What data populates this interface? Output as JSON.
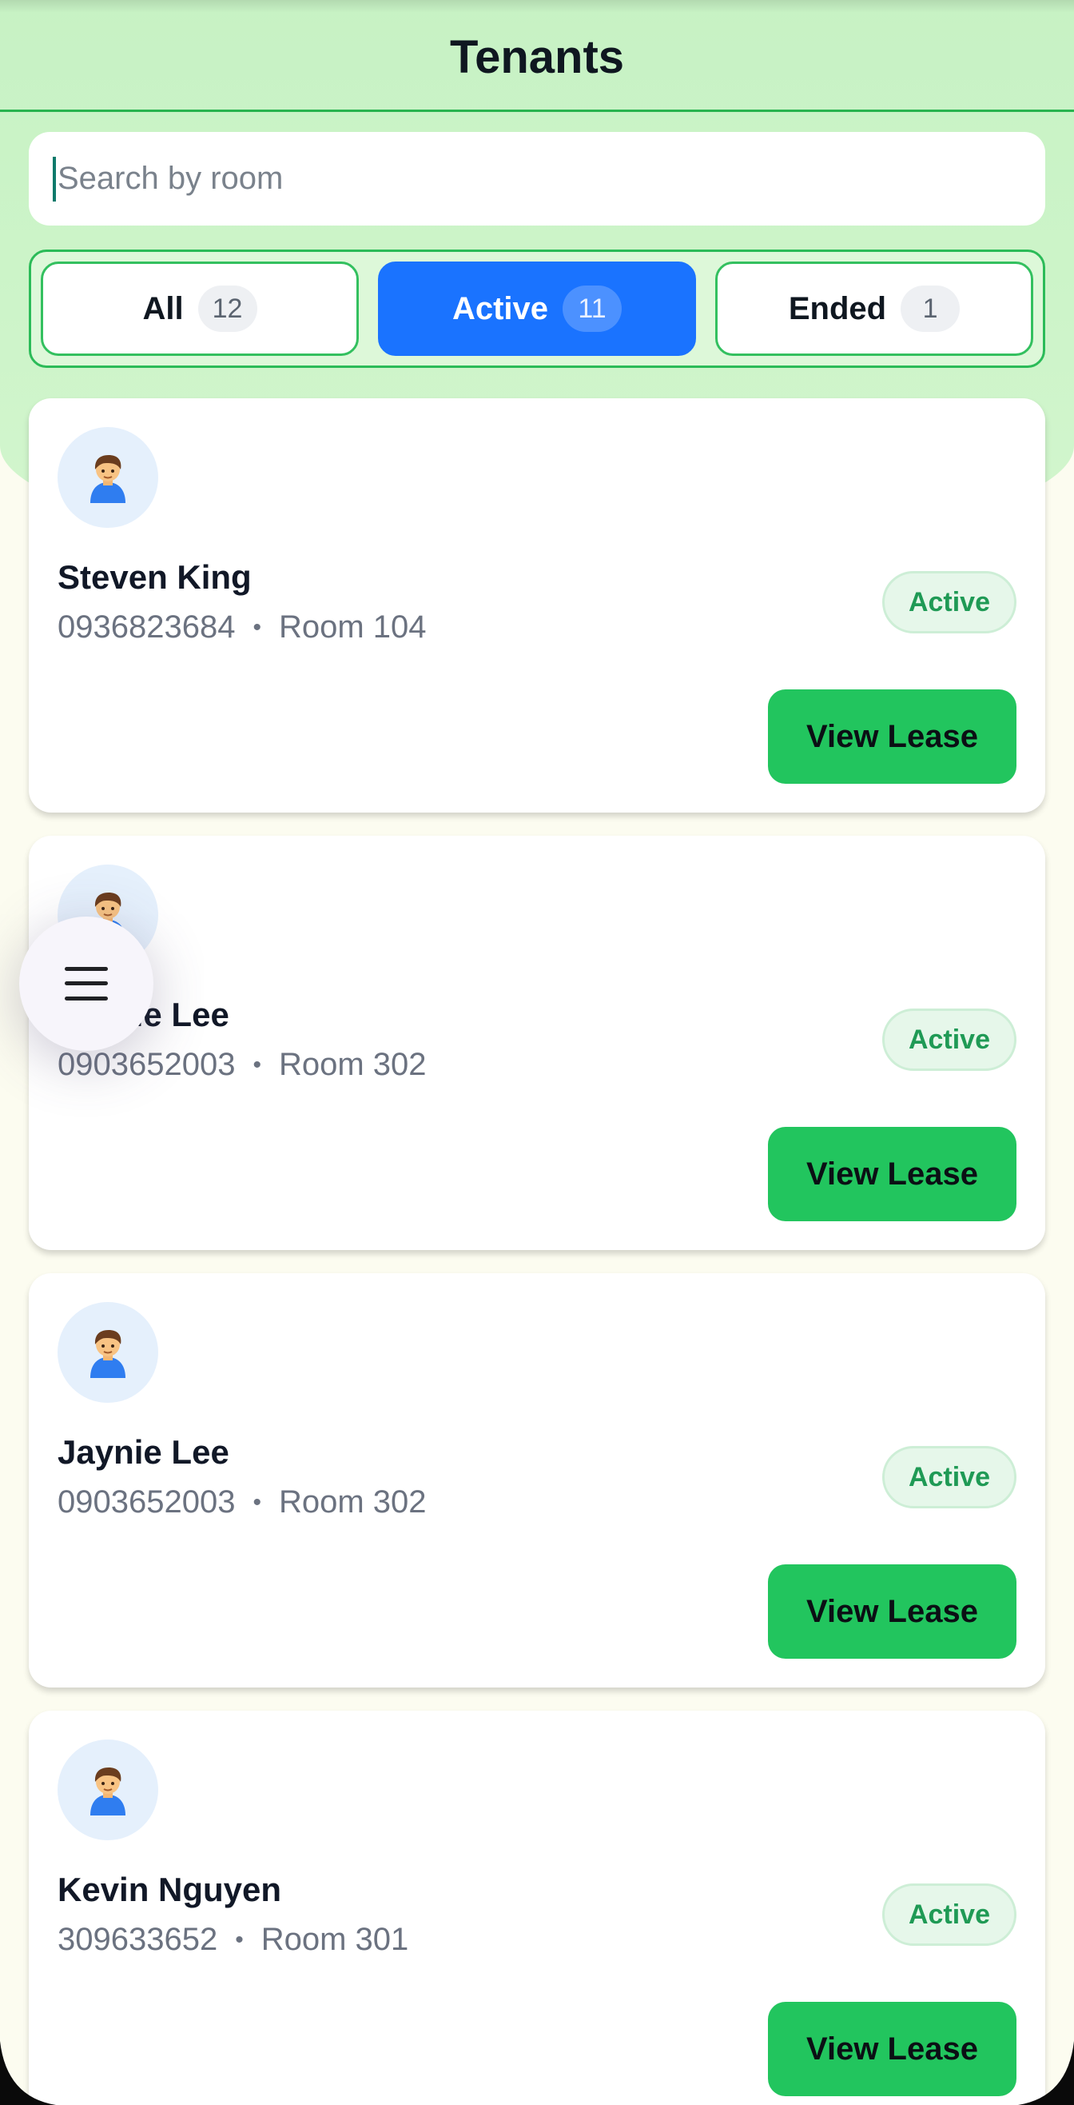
{
  "header": {
    "title": "Tenants"
  },
  "search": {
    "placeholder": "Search by room",
    "value": ""
  },
  "filters": [
    {
      "label": "All",
      "count": "12",
      "selected": false
    },
    {
      "label": "Active",
      "count": "11",
      "selected": true
    },
    {
      "label": "Ended",
      "count": "1",
      "selected": false
    }
  ],
  "tenants": [
    {
      "name": "Steven King",
      "phone": "0936823684",
      "separator": "•",
      "room": "Room 104",
      "status": "Active",
      "action": "View Lease",
      "icon": "person-icon"
    },
    {
      "name": "Jaynie Lee",
      "phone": "0903652003",
      "separator": "•",
      "room": "Room 302",
      "status": "Active",
      "action": "View Lease",
      "icon": "person-icon"
    },
    {
      "name": "Jaynie Lee",
      "phone": "0903652003",
      "separator": "•",
      "room": "Room 302",
      "status": "Active",
      "action": "View Lease",
      "icon": "person-icon"
    },
    {
      "name": "Kevin Nguyen",
      "phone": "309633652",
      "separator": "•",
      "room": "Room 301",
      "status": "Active",
      "action": "View Lease",
      "icon": "person-icon"
    }
  ],
  "fab": {
    "icon": "menu-icon"
  },
  "colors": {
    "header_bg": "#c7f2c4",
    "accent_blue": "#1a73ff",
    "action_green": "#22c55e",
    "status_green": "#1f9a55",
    "page_bg": "#fcfcf0"
  }
}
